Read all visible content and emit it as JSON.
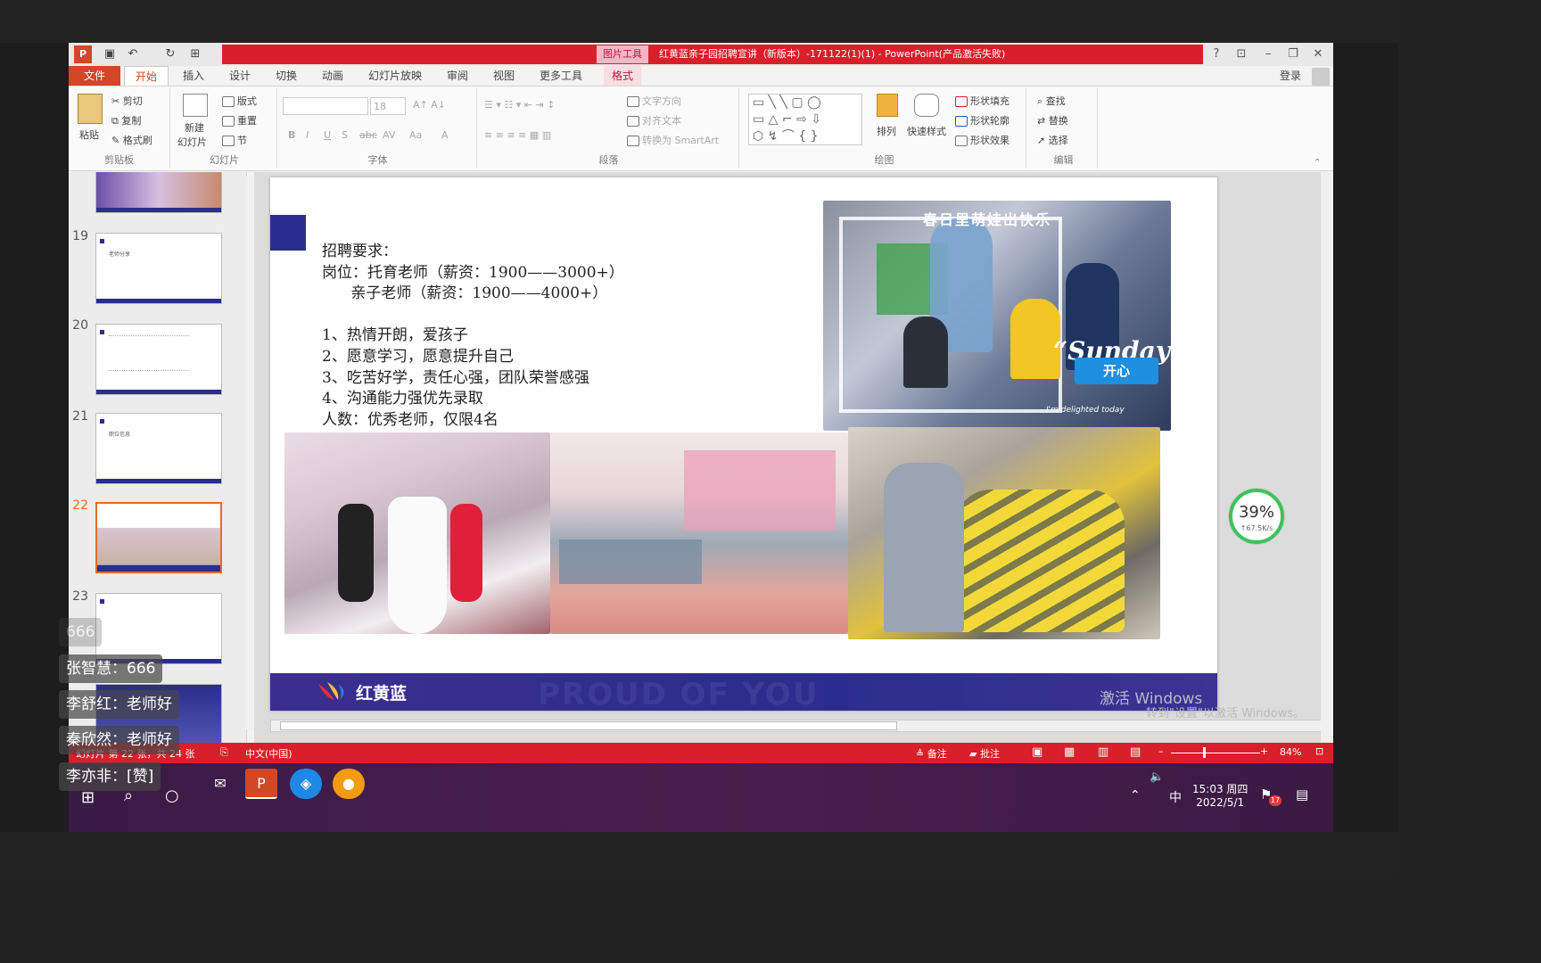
{
  "app": {
    "title": "红黄蓝亲子园招聘宣讲（新版本）-171122(1)(1) - PowerPoint(产品激活失败)",
    "context_tab": "图片工具",
    "login": "登录"
  },
  "tabs": [
    "文件",
    "开始",
    "插入",
    "设计",
    "切换",
    "动画",
    "幻灯片放映",
    "审阅",
    "视图",
    "更多工具",
    "格式"
  ],
  "ribbon": {
    "clipboard": {
      "paste": "粘贴",
      "cut": "剪切",
      "copy": "复制",
      "format_painter": "格式刷",
      "label": "剪贴板"
    },
    "slides": {
      "new_slide": "新建",
      "new_slide2": "幻灯片",
      "layout": "版式",
      "reset": "重置",
      "section": "节",
      "label": "幻灯片"
    },
    "font": {
      "size": "18",
      "label": "字体",
      "bold": "B",
      "italic": "I",
      "underline": "U",
      "shadow": "S",
      "strike": "abc",
      "spacing": "AV",
      "case": "Aa",
      "color": "A"
    },
    "paragraph": {
      "direction": "文字方向",
      "align": "对齐文本",
      "smartart": "转换为 SmartArt",
      "label": "段落"
    },
    "drawing": {
      "arrange": "排列",
      "quick_styles": "快速样式",
      "fill": "形状填充",
      "outline": "形状轮廓",
      "effects": "形状效果",
      "label": "绘图"
    },
    "editing": {
      "find": "查找",
      "replace": "替换",
      "select": "选择",
      "label": "编辑"
    }
  },
  "thumbnails": [
    {
      "num": "19",
      "text": "老师分享"
    },
    {
      "num": "20",
      "text": ""
    },
    {
      "num": "21",
      "text": "职位信息"
    },
    {
      "num": "22",
      "text": ""
    },
    {
      "num": "23",
      "text": ""
    }
  ],
  "slide": {
    "heading": "招聘要求：",
    "lines": [
      "岗位：托育老师（薪资：1900——3000+）",
      "      亲子老师（薪资：1900——4000+）",
      "",
      "1、热情开朗，爱孩子",
      "2、愿意学习，愿意提升自己",
      "3、吃苦好学，责任心强，团队荣誉感强",
      "4、沟通能力强优先录取",
      "人数：优秀老师，仅限4名"
    ],
    "photo_caption": "春日里萌娃出快乐",
    "sunday": "“Sunday”",
    "happy": "开心",
    "delighted": "I'm delighted today",
    "brand": "红黄蓝",
    "footer_ghost": "PROUD OF YOU",
    "activate_windows": "激活 Windows",
    "activate_hint": "转到\"设置\"以激活 Windows。"
  },
  "status": {
    "slide_info": "幻灯片 第 22 张，共 24 张",
    "language": "中文(中国)",
    "notes": "备注",
    "comments": "批注",
    "zoom": "84%"
  },
  "network": {
    "percent": "39%",
    "speed": "↑67.5K/s"
  },
  "chat": [
    {
      "user": "",
      "msg": "666"
    },
    {
      "user": "张智慧",
      "msg": "666"
    },
    {
      "user": "李舒红",
      "msg": "老师好"
    },
    {
      "user": "秦欣然",
      "msg": "老师好"
    },
    {
      "user": "李亦非",
      "msg": "[赞]"
    }
  ],
  "taskbar": {
    "time": "15:03 周四",
    "date": "2022/5/1",
    "ime": "中",
    "badge": "17"
  }
}
